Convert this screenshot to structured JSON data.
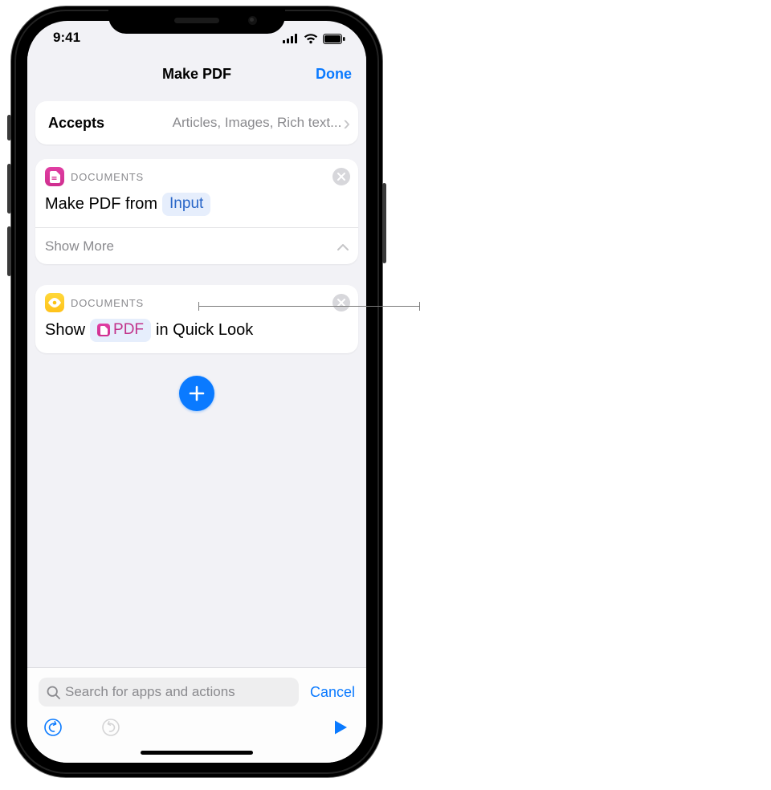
{
  "status": {
    "time": "9:41"
  },
  "nav": {
    "title": "Make PDF",
    "done": "Done"
  },
  "accepts": {
    "label": "Accepts",
    "value": "Articles, Images, Rich text..."
  },
  "action1": {
    "category": "DOCUMENTS",
    "prefix": "Make PDF from",
    "pill": "Input",
    "show_more": "Show More"
  },
  "action2": {
    "category": "DOCUMENTS",
    "prefix": "Show",
    "pill": "PDF",
    "suffix": "in Quick Look"
  },
  "search": {
    "placeholder": "Search for apps and actions",
    "cancel": "Cancel"
  }
}
